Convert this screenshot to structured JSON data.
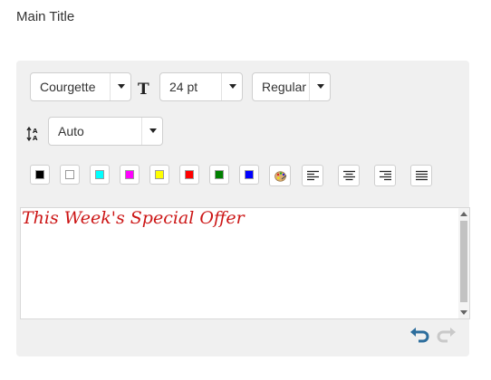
{
  "title": "Main Title",
  "toolbar": {
    "font": "Courgette",
    "size": "24 pt",
    "style": "Regular",
    "line_height": "Auto",
    "swatches": [
      {
        "name": "black",
        "color": "#000000"
      },
      {
        "name": "white",
        "color": "#ffffff"
      },
      {
        "name": "cyan",
        "color": "#00ffff"
      },
      {
        "name": "magenta",
        "color": "#ff00ff"
      },
      {
        "name": "yellow",
        "color": "#ffff00"
      },
      {
        "name": "red",
        "color": "#ff0000"
      },
      {
        "name": "green",
        "color": "#008000"
      },
      {
        "name": "blue",
        "color": "#0000ff"
      }
    ],
    "icons": [
      "text-size-icon",
      "line-height-icon",
      "palette-icon",
      "align-left-icon",
      "align-center-icon",
      "align-right-icon",
      "align-justify-icon",
      "undo-icon",
      "redo-icon"
    ]
  },
  "editor": {
    "text": "This Week's Special Offer",
    "text_color": "#cc1616"
  }
}
